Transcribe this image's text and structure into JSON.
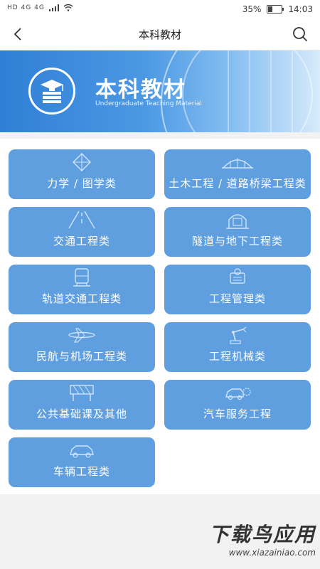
{
  "status_bar": {
    "signal_text": "HD 4G 4G",
    "battery_percent": "35%",
    "battery_level": 0.35,
    "time": "14:03"
  },
  "nav": {
    "title": "本科教材",
    "back_icon": "chevron-left-icon",
    "search_icon": "search-icon"
  },
  "banner": {
    "title": "本科教材",
    "subtitle": "Undergraduate Teaching Material"
  },
  "categories": [
    {
      "label": "力学 / 图学类",
      "icon": "geometry-icon"
    },
    {
      "label": "土木工程 / 道路桥梁工程类",
      "icon": "bridge-icon"
    },
    {
      "label": "交通工程类",
      "icon": "road-icon"
    },
    {
      "label": "隧道与地下工程类",
      "icon": "tunnel-icon"
    },
    {
      "label": "轨道交通工程类",
      "icon": "train-icon"
    },
    {
      "label": "工程管理类",
      "icon": "management-icon"
    },
    {
      "label": "民航与机场工程类",
      "icon": "airplane-icon"
    },
    {
      "label": "工程机械类",
      "icon": "robot-arm-icon"
    },
    {
      "label": "公共基础课及其他",
      "icon": "fence-icon"
    },
    {
      "label": "汽车服务工程",
      "icon": "car-gear-icon"
    },
    {
      "label": "车辆工程类",
      "icon": "car-icon"
    }
  ],
  "watermark": {
    "text": "下载鸟应用",
    "url": "www.xiazainiao.com"
  },
  "colors": {
    "tile": "#5f9fe0",
    "banner_start": "#2f7fd6",
    "banner_end": "#d6ebfb"
  }
}
